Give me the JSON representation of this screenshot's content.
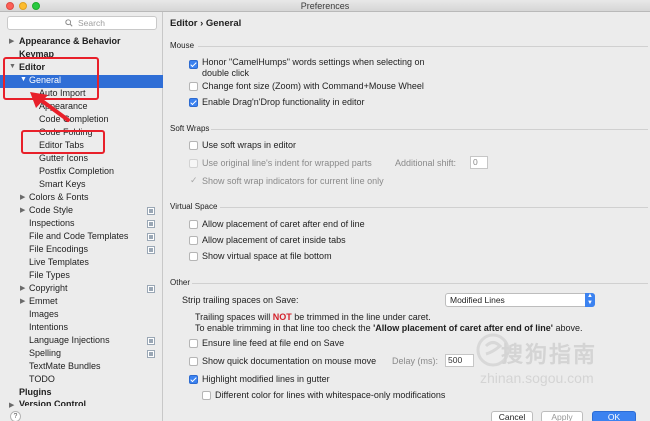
{
  "window": {
    "title": "Preferences"
  },
  "sidebar": {
    "search_placeholder": "Search",
    "items": [
      {
        "label": "Appearance & Behavior"
      },
      {
        "label": "Keymap"
      },
      {
        "label": "Editor"
      },
      {
        "label": "General"
      },
      {
        "label": "Auto Import"
      },
      {
        "label": "Appearance"
      },
      {
        "label": "Code Completion"
      },
      {
        "label": "Code Folding"
      },
      {
        "label": "Editor Tabs"
      },
      {
        "label": "Gutter Icons"
      },
      {
        "label": "Postfix Completion"
      },
      {
        "label": "Smart Keys"
      },
      {
        "label": "Colors & Fonts"
      },
      {
        "label": "Code Style"
      },
      {
        "label": "Inspections"
      },
      {
        "label": "File and Code Templates"
      },
      {
        "label": "File Encodings"
      },
      {
        "label": "Live Templates"
      },
      {
        "label": "File Types"
      },
      {
        "label": "Copyright"
      },
      {
        "label": "Emmet"
      },
      {
        "label": "Images"
      },
      {
        "label": "Intentions"
      },
      {
        "label": "Language Injections"
      },
      {
        "label": "Spelling"
      },
      {
        "label": "TextMate Bundles"
      },
      {
        "label": "TODO"
      },
      {
        "label": "Plugins"
      },
      {
        "label": "Version Control"
      }
    ]
  },
  "main": {
    "breadcrumb": "Editor › General",
    "sections": {
      "mouse": "Mouse",
      "soft_wraps": "Soft Wraps",
      "virtual_space": "Virtual Space",
      "other": "Other"
    },
    "options": {
      "camel_humps_line1": "Honor \"CamelHumps\" words settings when selecting on",
      "camel_humps_line2": "double click",
      "change_font": "Change font size (Zoom) with Command+Mouse Wheel",
      "drag_drop": "Enable Drag'n'Drop functionality in editor",
      "soft_wraps_editor": "Use soft wraps in editor",
      "original_indent": "Use original line's indent for wrapped parts",
      "additional_shift_label": "Additional shift:",
      "additional_shift_value": "0",
      "show_wrap_indicators": "Show soft wrap indicators for current line only",
      "caret_after_eol": "Allow placement of caret after end of line",
      "caret_inside_tabs": "Allow placement of caret inside tabs",
      "virtual_space_bottom": "Show virtual space at file bottom",
      "strip_label": "Strip trailing spaces on Save:",
      "strip_value": "Modified Lines",
      "note1_a": "Trailing spaces will ",
      "note1_not": "NOT",
      "note1_b": " be trimmed in the line under caret.",
      "note2_a": "To enable trimming in that line too check the ",
      "note2_bold": "'Allow placement of caret after end of line'",
      "note2_b": " above.",
      "line_feed": "Ensure line feed at file end on Save",
      "quick_doc": "Show quick documentation on mouse move",
      "delay_label": "Delay (ms):",
      "delay_value": "500",
      "highlight_modified": "Highlight modified lines in gutter",
      "different_color": "Different color for lines with whitespace-only modifications"
    }
  },
  "footer": {
    "help": "?",
    "cancel": "Cancel",
    "apply": "Apply",
    "ok": "OK"
  },
  "watermark": {
    "text": "搜狗指南",
    "url": "zhinan.sogou.com"
  },
  "colors": {
    "selection": "#2f6ed6",
    "accent": "#3b82f0",
    "annotation": "#e8202a",
    "not_red": "#d3202a"
  }
}
